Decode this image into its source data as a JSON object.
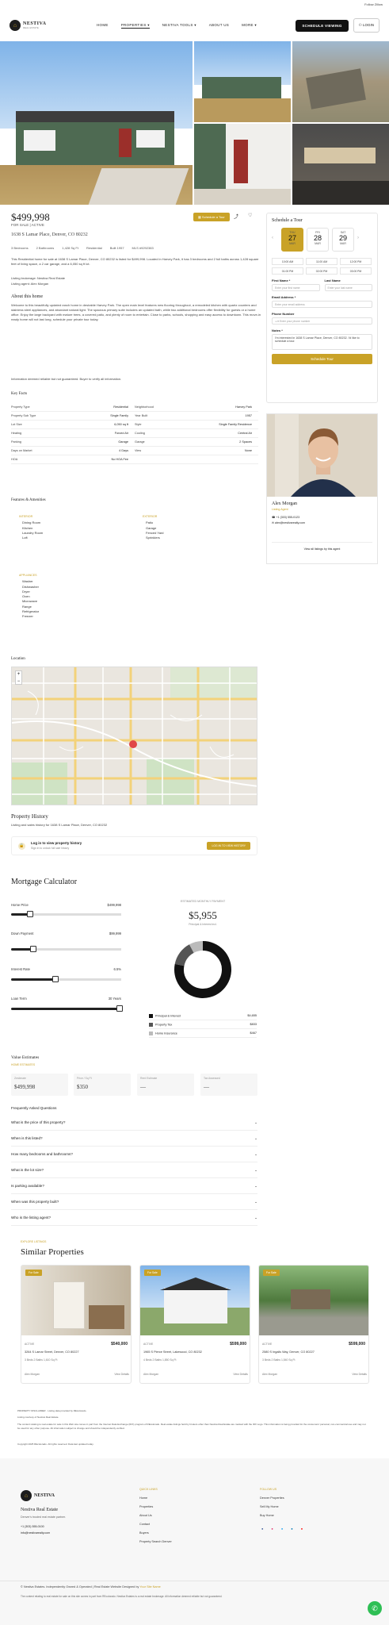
{
  "topbar": {
    "right_text": "Follow Zillow"
  },
  "header": {
    "logo_text": "NESTIVA",
    "logo_sub": "REAL ESTATE",
    "nav": [
      "HOME",
      "PROPERTIES",
      "NESTIVA TOOLS",
      "ABOUT US",
      "MORE"
    ],
    "cta": "SCHEDULE VIEWING",
    "login": "LOGIN"
  },
  "listing": {
    "price": "$499,998",
    "sub1": "FOR SALE | ACTIVE",
    "address": "1638 S Lamar Place, Denver, CO 80232",
    "save_label": "Schedule a Tour",
    "facts": [
      "3 Bedrooms",
      "2 Bathrooms",
      "1,428 Sq Ft",
      "Residential",
      "Built 1957",
      "MLS #9292383"
    ],
    "summary": "This Residential home for sale at 1638 S Lamar Place, Denver, CO 80232 is listed for $499,998. Located in Harvey Park, it has 3 bedrooms and 2 full baths across 1,428 square feet of living space, a 2 car garage, and a 6,050 sq ft lot.",
    "listed_by_1": "Listing brokerage: Nestiva Real Estate",
    "listed_by_2": "Listing agent: Alex Morgan",
    "about_title": "About this home",
    "about_text": "Welcome to this beautifully updated ranch home in desirable Harvey Park. The open main level features new flooring throughout, a remodeled kitchen with quartz counters and stainless steel appliances, and abundant natural light. The spacious primary suite includes an updated bath, while two additional bedrooms offer flexibility for guests or a home office. Enjoy the large backyard with mature trees, a covered patio, and plenty of room to entertain. Close to parks, schools, shopping and easy access to downtown. This move-in ready home will not last long, schedule your private tour today.",
    "disclaimer_line": "Information deemed reliable but not guaranteed. Buyer to verify all information.",
    "key_facts_title": "Key Facts",
    "key_facts": [
      [
        "Property Type",
        "Residential",
        "Neighborhood",
        "Harvey Park"
      ],
      [
        "Property Sub Type",
        "Single Family",
        "Year Built",
        "1957"
      ],
      [
        "Lot Size",
        "6,050 sq ft",
        "Style",
        "Single Family Residence"
      ],
      [
        "Heating",
        "Forced Air",
        "Cooling",
        "Central Air"
      ],
      [
        "Parking",
        "Garage",
        "Garage",
        "2 Spaces"
      ],
      [
        "Days on Market",
        "4 Days",
        "View",
        "None"
      ],
      [
        "HOA",
        "No HOA Fee",
        "",
        ""
      ]
    ],
    "features_title": "Features & Amenities",
    "features_left_head": "INTERIOR",
    "features_left": [
      "Dining Room",
      "Kitchen",
      "Laundry Room",
      "Loft"
    ],
    "features_right_head": "EXTERIOR",
    "features_right": [
      "Patio",
      "Garage",
      "Fenced Yard",
      "Sprinklers"
    ],
    "appliances_head": "APPLIANCES",
    "appliances": [
      "Washer",
      "Dishwasher",
      "Dryer",
      "Oven",
      "Microwave",
      "Range",
      "Refrigerator",
      "Freezer"
    ],
    "location_title": "Location"
  },
  "tour": {
    "title": "Schedule a Tour",
    "dates": [
      {
        "dow": "THU",
        "day": "27",
        "mon": "MAR"
      },
      {
        "dow": "FRI",
        "day": "28",
        "mon": "MAR"
      },
      {
        "dow": "SAT",
        "day": "29",
        "mon": "MAR"
      }
    ],
    "times": [
      "10:00 AM",
      "11:00 AM",
      "12:00 PM",
      "01:00 PM",
      "02:00 PM",
      "03:00 PM"
    ],
    "first_name": "First Name *",
    "last_name": "Last Name",
    "first_ph": "Enter your first name",
    "last_ph": "Enter your last name",
    "email": "Email Address *",
    "email_ph": "Enter your email address",
    "phone": "Phone Number",
    "phone_ph": "Enter your phone number",
    "notes": "Notes *",
    "notes_val": "I'm interested in 1638 S Lamar Place, Denver, CO 80232. I'd like to schedule a tour.",
    "submit": "Schedule Tour"
  },
  "agent": {
    "name": "Alex Morgan",
    "role": "Listing Agent",
    "phone": "+1 (303) 555-0123",
    "email": "alex@nestivarealty.com",
    "link": "View all listings by this agent"
  },
  "history": {
    "title": "Property History",
    "sub": "Listing and sales history for 1638 S Lamar Place, Denver, CO 80232",
    "login_title": "Log in to view property history",
    "login_sub": "Sign in to unlock full sale history",
    "login_btn": "LOG IN TO VIEW HISTORY"
  },
  "mortgage": {
    "title": "Mortgage Calculator",
    "home_price_label": "Home Price",
    "home_price": "$499,998",
    "down_label": "Down Payment",
    "down": "$99,999",
    "rate_label": "Interest Rate",
    "rate": "6.5%",
    "term_label": "Loan Term",
    "term": "30 Years",
    "est_label": "ESTIMATED MONTHLY PAYMENT",
    "est_value": "$5,955",
    "est_sub": "Principal & Interest incl.",
    "legend": [
      {
        "name": "Principal & Interest",
        "value": "$4,655",
        "color": "#111111"
      },
      {
        "name": "Property Tax",
        "value": "$833",
        "color": "#555555"
      },
      {
        "name": "Home Insurance",
        "value": "$467",
        "color": "#bbbbbb"
      }
    ]
  },
  "chart_data": {
    "type": "pie",
    "categories": [
      "Principal & Interest",
      "Property Tax",
      "Home Insurance"
    ],
    "values": [
      4655,
      833,
      467
    ],
    "title": "$5,955"
  },
  "values": {
    "title": "Value Estimates",
    "sub": "HOME ESTIMATES",
    "boxes": [
      {
        "label": "Zestimate",
        "value": "$499,998"
      },
      {
        "label": "Price / Sq Ft",
        "value": "$350"
      },
      {
        "label": "Rent Estimate",
        "value": "—"
      },
      {
        "label": "Tax Assessed",
        "value": "—"
      }
    ]
  },
  "faq": {
    "title": "Frequently Asked Questions",
    "items": [
      "What is the price of this property?",
      "When is this listed?",
      "How many bedrooms and bathrooms?",
      "What is the lot size?",
      "Is parking available?",
      "When was this property built?",
      "Who is the listing agent?"
    ]
  },
  "similar": {
    "eyebrow": "EXPLORE LISTINGS",
    "title": "Similar Properties",
    "cards": [
      {
        "badge": "For Sale",
        "tag": "ACTIVE",
        "price": "$540,000",
        "addr": "3264 S Lamar Street, Denver, CO 80227",
        "facts": "3 Beds  2 Baths  1,610 Sq Ft",
        "agent": "Alex Morgan",
        "more": "View Details"
      },
      {
        "badge": "For Sale",
        "tag": "ACTIVE",
        "price": "$599,000",
        "addr": "1965 S Pierce Street, Lakewood, CO 80232",
        "facts": "4 Beds  2 Baths  1,850 Sq Ft",
        "agent": "Alex Morgan",
        "more": "View Details"
      },
      {
        "badge": "For Sale",
        "tag": "ACTIVE",
        "price": "$599,000",
        "addr": "2580 S Ingalls Way, Denver, CO 80227",
        "facts": "3 Beds  2 Baths  1,540 Sq Ft",
        "agent": "Alex Morgan",
        "more": "View Details"
      }
    ]
  },
  "disclaimer": [
    "PROPERTY DISCLAIMER · Listing data provided by REcolorado.",
    "Listing courtesy of Nestiva Real Estate.",
    "The content relating to real estate for sale in this Web site comes in part from the Internet Data Exchange (IDX) program of REcolorado. Real estate listings held by brokers other than Nestiva Real Estate are marked with the IDX Logo. This information is being provided for the consumers' personal, non-commercial use and may not be used for any other purpose. All information subject to change and should be independently verified.",
    "Copyright 2025 REcolorado. All rights reserved. Data last updated today."
  ],
  "footer": {
    "tagline": "Nestiva Real Estate",
    "desc": "Denver's trusted real estate partner.",
    "phone": "+1 (303) 555-0100",
    "email": "info@nestivarealty.com",
    "col2_head": "QUICK LINKS",
    "col2": [
      "Home",
      "Properties",
      "About Us",
      "Contact",
      "Buyers",
      "Property Search Denver"
    ],
    "col3_head": "FOLLOW US",
    "col3": [
      "Denver Properties",
      "Sell My Home",
      "Buy Home"
    ],
    "copyright": "© Nestiva Estates. Independently Owned & Operated | Real Estate Website Designed by ",
    "copyright_link": "Your Site Name",
    "legal": "The content relating to real estate for sale on this site comes in part from REcolorado. Nestiva Estates is a real estate brokerage. All information deemed reliable but not guaranteed.",
    "colors": {
      "gold": "#c9a227",
      "dark": "#111111",
      "chat": "#2fbf55"
    }
  }
}
